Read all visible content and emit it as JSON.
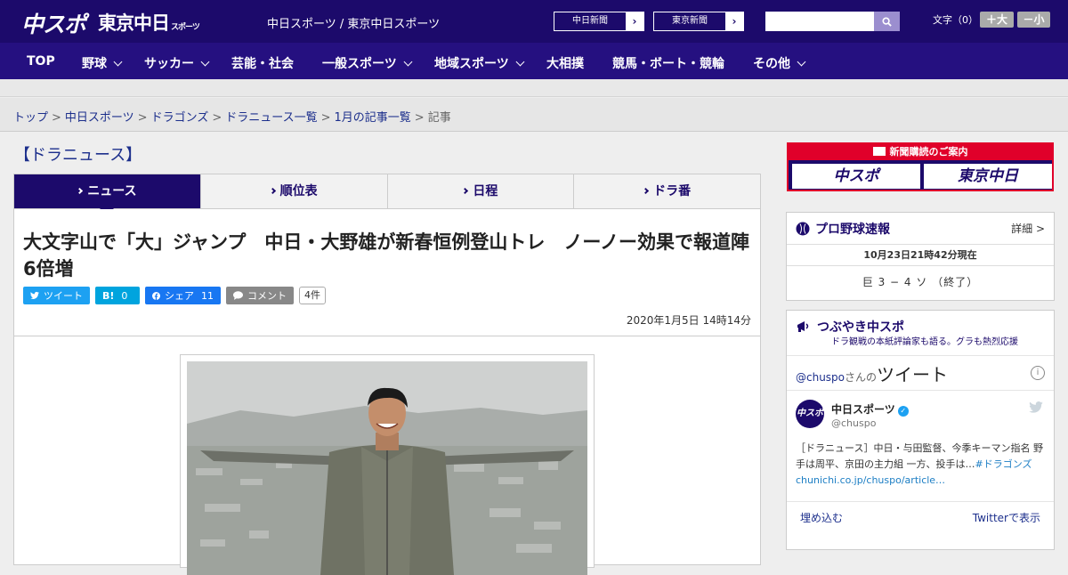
{
  "header": {
    "logo_main": "中スポ",
    "logo_sub": "東京中日",
    "logo_sub_small": "スポーツ",
    "site_title": "中日スポーツ / 東京中日スポーツ",
    "paper_buttons": [
      "中日新聞",
      "東京新聞"
    ],
    "font_size_label": "文字（0）",
    "font_bigger": "＋大",
    "font_smaller": "－小",
    "search_placeholder": ""
  },
  "nav": {
    "items": [
      {
        "label": "TOP",
        "dropdown": false
      },
      {
        "label": "野球",
        "dropdown": true
      },
      {
        "label": "サッカー",
        "dropdown": true
      },
      {
        "label": "芸能・社会",
        "dropdown": false
      },
      {
        "label": "一般スポーツ",
        "dropdown": true
      },
      {
        "label": "地域スポーツ",
        "dropdown": true
      },
      {
        "label": "大相撲",
        "dropdown": false
      },
      {
        "label": "競馬・ボート・競輪",
        "dropdown": false
      },
      {
        "label": "その他",
        "dropdown": true
      }
    ]
  },
  "breadcrumb": {
    "links": [
      "トップ",
      "中日スポーツ",
      "ドラゴンズ",
      "ドラニュース一覧",
      "1月の記事一覧"
    ],
    "current": "記事",
    "separator": ">"
  },
  "main": {
    "section_title": "【ドラニュース】",
    "tabs": [
      "ニュース",
      "順位表",
      "日程",
      "ドラ番"
    ],
    "active_tab": 0,
    "headline": "大文字山で「大」ジャンプ　中日・大野雄が新春恒例登山トレ　ノーノー効果で報道陣6倍増",
    "social": {
      "tweet": "ツイート",
      "hatena": "B!",
      "hatena_count": "0",
      "facebook": "シェア",
      "facebook_count": "11",
      "comment": "コメント",
      "comment_count": "4件"
    },
    "date": "2020年1月5日 14時14分"
  },
  "sidebar": {
    "promo": {
      "title": "新聞購読のご案内",
      "left": "中スポ",
      "right": "東京中日"
    },
    "scores": {
      "title": "プロ野球速報",
      "more": "詳細 >",
      "time": "10月23日21時42分現在",
      "line": "巨 3 − 4 ソ （終了）"
    },
    "tweets": {
      "title": "つぶやき中スポ",
      "subtitle": "ドラ観戦の本紙評論家も語る。グラも熱烈応援",
      "handle_link": "@chuspo",
      "handle_suffix": "さんの",
      "header_big": "ツイート",
      "user_name": "中日スポーツ",
      "user_handle": "@chuspo",
      "avatar_text": "中スポ",
      "text": "［ドラニュース］中日・与田監督、今季キーマン指名 野手は周平、京田の主力組 一方、投手は…",
      "text_link": "#ドラゴンズchunichi.co.jp/chuspo/article…",
      "embed": "埋め込む",
      "view_on": "Twitterで表示"
    }
  },
  "colors": {
    "brand": "#1c0a6b",
    "nav": "#251080",
    "promo_red": "#e0002a",
    "twitter": "#1da1f2",
    "facebook": "#1877f2"
  }
}
